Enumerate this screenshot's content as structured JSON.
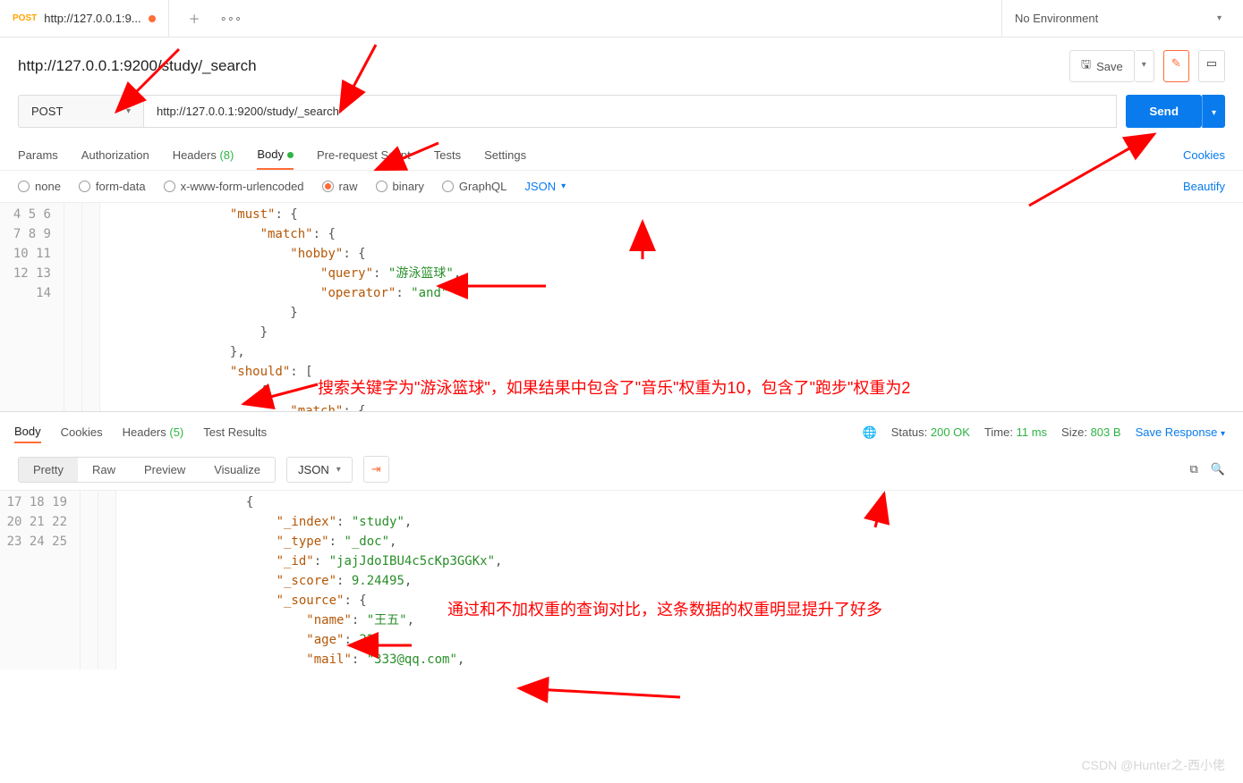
{
  "tab": {
    "method": "POST",
    "title": "http://127.0.0.1:9..."
  },
  "env": {
    "label": "No Environment"
  },
  "request": {
    "title": "http://127.0.0.1:9200/study/_search",
    "save": "Save",
    "method": "POST",
    "url": "http://127.0.0.1:9200/study/_search",
    "send": "Send"
  },
  "reqTabs": {
    "params": "Params",
    "auth": "Authorization",
    "headers": "Headers",
    "headersCount": "(8)",
    "body": "Body",
    "prereq": "Pre-request Script",
    "tests": "Tests",
    "settings": "Settings",
    "cookies": "Cookies"
  },
  "bodyTypes": {
    "none": "none",
    "form": "form-data",
    "xform": "x-www-form-urlencoded",
    "raw": "raw",
    "binary": "binary",
    "graphql": "GraphQL",
    "json": "JSON",
    "beautify": "Beautify"
  },
  "code": {
    "startLine": 4,
    "lines": [
      {
        "indent": 4,
        "prefix": "\"",
        "key": "must",
        "mid": "\" : ",
        "after": "{"
      },
      {
        "indent": 5,
        "prefix": "\"",
        "key": "match",
        "mid": "\": ",
        "after": "{"
      },
      {
        "indent": 6,
        "prefix": "\"",
        "key": "hobby",
        "mid": "\": ",
        "after": "{"
      },
      {
        "indent": 7,
        "prefix": "\"",
        "key": "query",
        "mid": "\": ",
        "strVal": "\"游泳篮球\"",
        "after": ","
      },
      {
        "indent": 7,
        "prefix": "\"",
        "key": "operator",
        "mid": "\": ",
        "strVal": "\"and\"",
        "after": ""
      },
      {
        "indent": 6,
        "after": "}"
      },
      {
        "indent": 5,
        "after": "}"
      },
      {
        "indent": 4,
        "after": "},"
      },
      {
        "indent": 4,
        "prefix": "\"",
        "key": "should",
        "mid": "\": ",
        "after": "["
      },
      {
        "indent": 5,
        "after": "{"
      },
      {
        "indent": 6,
        "prefix": "\"",
        "key": "match",
        "mid": "\": ",
        "after": "{"
      }
    ]
  },
  "respTabs": {
    "body": "Body",
    "cookies": "Cookies",
    "headers": "Headers",
    "headersCount": "(5)",
    "tests": "Test Results"
  },
  "respMeta": {
    "statusLabel": "Status:",
    "statusVal": "200 OK",
    "timeLabel": "Time:",
    "timeVal": "11 ms",
    "sizeLabel": "Size:",
    "sizeVal": "803 B",
    "save": "Save Response"
  },
  "respTools": {
    "pretty": "Pretty",
    "raw": "Raw",
    "preview": "Preview",
    "visualize": "Visualize",
    "json": "JSON"
  },
  "respCode": {
    "startLine": 17,
    "lines": [
      {
        "indent": 4,
        "after": "{"
      },
      {
        "indent": 5,
        "prefix": "\"",
        "key": "_index",
        "mid": "\": ",
        "strVal": "\"study\"",
        "after": ","
      },
      {
        "indent": 5,
        "prefix": "\"",
        "key": "_type",
        "mid": "\": ",
        "strVal": "\"_doc\"",
        "after": ","
      },
      {
        "indent": 5,
        "prefix": "\"",
        "key": "_id",
        "mid": "\": ",
        "strVal": "\"jajJdoIBU4c5cKp3GGKx\"",
        "after": ","
      },
      {
        "indent": 5,
        "prefix": "\"",
        "key": "_score",
        "mid": "\": ",
        "numVal": "9.24495",
        "after": ","
      },
      {
        "indent": 5,
        "prefix": "\"",
        "key": "_source",
        "mid": "\": ",
        "after": "{"
      },
      {
        "indent": 6,
        "prefix": "\"",
        "key": "name",
        "mid": "\": ",
        "strVal": "\"王五\"",
        "after": ","
      },
      {
        "indent": 6,
        "prefix": "\"",
        "key": "age",
        "mid": "\": ",
        "numVal": "22",
        "after": ","
      },
      {
        "indent": 6,
        "prefix": "\"",
        "key": "mail",
        "mid": "\": ",
        "strVal": "\"333@qq.com\"",
        "after": ","
      }
    ]
  },
  "annot": {
    "a1": "搜索关键字为\"游泳篮球\"，如果结果中包含了\"音乐\"权重为10，包含了\"跑步\"权重为2",
    "a2": "通过和不加权重的查询对比，这条数据的权重明显提升了好多"
  },
  "watermark": "CSDN @Hunter之-西小佬"
}
